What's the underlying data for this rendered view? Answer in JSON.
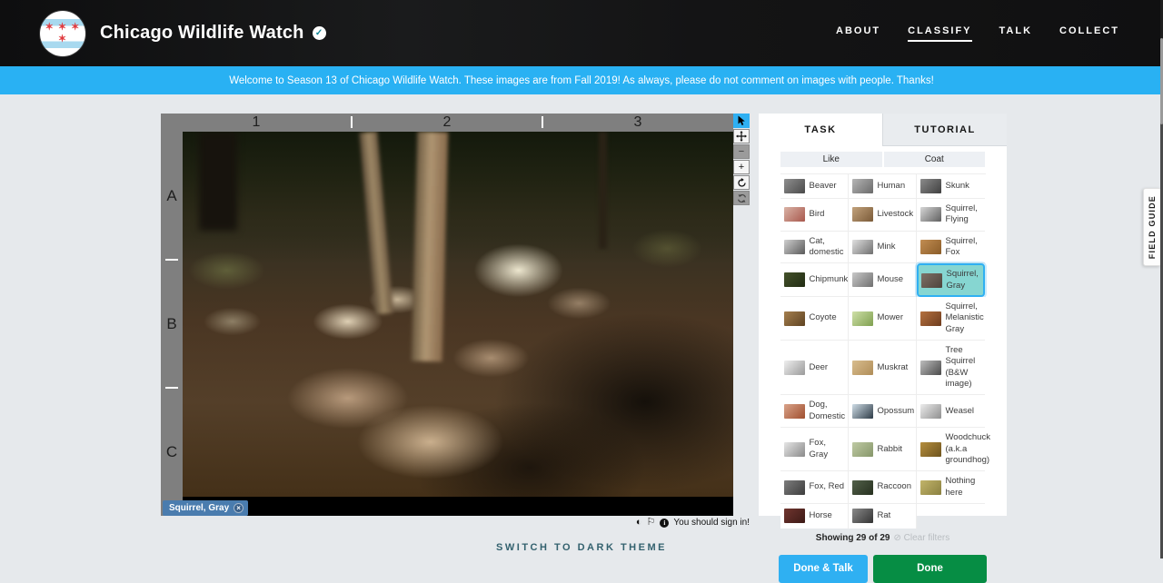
{
  "colors": {
    "banner_blue": "#29b1f3",
    "accent_blue": "#2fb0f2",
    "done_green": "#068d44",
    "selected_teal": "#86d6d1",
    "tag_blue": "#4a7cae",
    "ruler_gray": "#7f7f7f"
  },
  "header": {
    "title": "Chicago Wildlife Watch",
    "verified_check": "✓",
    "logo_stars": "✶ ✶ ✶ ✶",
    "nav": [
      {
        "label": "ABOUT"
      },
      {
        "label": "CLASSIFY"
      },
      {
        "label": "TALK"
      },
      {
        "label": "COLLECT"
      }
    ]
  },
  "banner": {
    "text": "Welcome to Season 13 of Chicago Wildlife Watch. These images are from Fall 2019! As always, please do not comment on images with people. Thanks!"
  },
  "viewer": {
    "cols": [
      "1",
      "2",
      "3"
    ],
    "rows": [
      "A",
      "B",
      "C"
    ],
    "tag": {
      "label": "Squirrel, Gray",
      "close": "×"
    },
    "toolbar": [
      "pointer",
      "pan",
      "zoom-out",
      "zoom-in",
      "rotate",
      "reset"
    ],
    "signin": {
      "contrast_icon": "◐",
      "flag_icon": "⚐",
      "info_icon": "i",
      "note": "You should sign in!"
    }
  },
  "panel": {
    "tabs": {
      "task": "TASK",
      "tutorial": "TUTORIAL"
    },
    "filters": {
      "like": "Like",
      "coat": "Coat"
    },
    "choices": [
      {
        "label": "Beaver",
        "thumb": [
          "#8f8f8f",
          "#4a4a4a"
        ]
      },
      {
        "label": "Human",
        "thumb": [
          "#b5b5b5",
          "#6a6a6a"
        ]
      },
      {
        "label": "Skunk",
        "thumb": [
          "#8c8c8c",
          "#3f3f3f"
        ]
      },
      {
        "label": "Bird",
        "thumb": [
          "#d9b3a6",
          "#a8584d"
        ]
      },
      {
        "label": "Livestock",
        "thumb": [
          "#c2a27c",
          "#7a5a38"
        ]
      },
      {
        "label": "Squirrel, Flying",
        "thumb": [
          "#d6d6d6",
          "#5f5f5f"
        ]
      },
      {
        "label": "Cat, domestic",
        "thumb": [
          "#cfcfcf",
          "#5a5a5a"
        ]
      },
      {
        "label": "Mink",
        "thumb": [
          "#e0e0e0",
          "#6f6f6f"
        ]
      },
      {
        "label": "Squirrel, Fox",
        "thumb": [
          "#c28d52",
          "#8a5c28"
        ]
      },
      {
        "label": "Chipmunk",
        "thumb": [
          "#44522a",
          "#222c14"
        ]
      },
      {
        "label": "Mouse",
        "thumb": [
          "#c9c9c9",
          "#707070"
        ]
      },
      {
        "label": "Squirrel, Gray",
        "thumb": [
          "#7d7066",
          "#4e443c"
        ],
        "selected": true
      },
      {
        "label": "Coyote",
        "thumb": [
          "#a57f4e",
          "#5f4322"
        ]
      },
      {
        "label": "Mower",
        "thumb": [
          "#cfe0a8",
          "#7fa050"
        ]
      },
      {
        "label": "Squirrel, Melanistic Gray",
        "thumb": [
          "#b5713f",
          "#6e3c1e"
        ]
      },
      {
        "label": "Deer",
        "thumb": [
          "#efefef",
          "#9a9a9a"
        ]
      },
      {
        "label": "Muskrat",
        "thumb": [
          "#d8bd8e",
          "#b08d58"
        ]
      },
      {
        "label": "Tree Squirrel (B&W image)",
        "thumb": [
          "#bdbdbd",
          "#4a4a4a"
        ]
      },
      {
        "label": "Dog, Domestic",
        "thumb": [
          "#d9a38a",
          "#a04f2f"
        ]
      },
      {
        "label": "Opossum",
        "thumb": [
          "#cfdde6",
          "#2e3c48"
        ]
      },
      {
        "label": "Weasel",
        "thumb": [
          "#ececec",
          "#8f8f8f"
        ]
      },
      {
        "label": "Fox, Gray",
        "thumb": [
          "#e6e6e6",
          "#8a8a8a"
        ]
      },
      {
        "label": "Rabbit",
        "thumb": [
          "#bfcaa4",
          "#86966a"
        ]
      },
      {
        "label": "Woodchuck (a.k.a groundhog)",
        "thumb": [
          "#b58e3e",
          "#6e541e"
        ]
      },
      {
        "label": "Fox, Red",
        "thumb": [
          "#7d7d7d",
          "#3d3d3d"
        ]
      },
      {
        "label": "Raccoon",
        "thumb": [
          "#53614a",
          "#26301f"
        ]
      },
      {
        "label": "Nothing here",
        "thumb": [
          "#c2b46a",
          "#8a8040"
        ]
      },
      {
        "label": "Horse",
        "thumb": [
          "#70352f",
          "#3c1a16"
        ]
      },
      {
        "label": "Rat",
        "thumb": [
          "#8a8a8a",
          "#333333"
        ]
      }
    ],
    "status": {
      "showing": "Showing 29 of 29",
      "clear_icon": "⊘",
      "clear_filters": "Clear filters"
    },
    "buttons": {
      "done_talk": "Done & Talk",
      "done": "Done"
    }
  },
  "field_guide": {
    "label": "FIELD GUIDE"
  },
  "footer": {
    "theme_toggle": "SWITCH TO DARK THEME"
  }
}
